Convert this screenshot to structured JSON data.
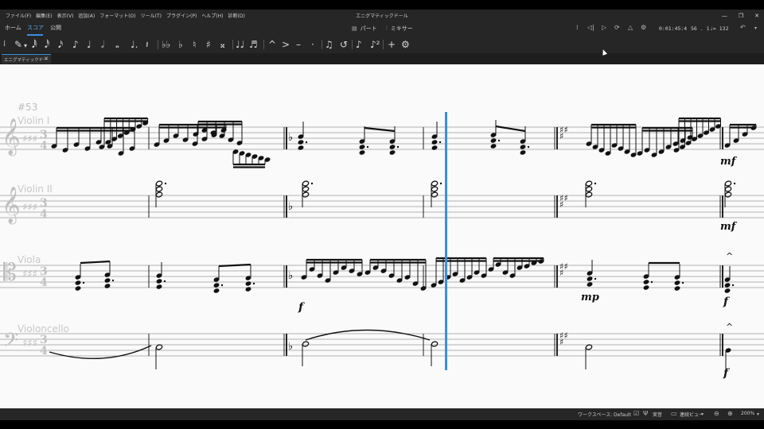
{
  "window": {
    "title": "エニグマティックドール",
    "menu": [
      "ファイル(F)",
      "編集(E)",
      "表示(V)",
      "追加(A)",
      "フォーマット(O)",
      "ツール(T)",
      "プラグイン(P)",
      "ヘルプ(H)",
      "診断(D)"
    ]
  },
  "tabs": {
    "home": "ホーム",
    "score": "スコア",
    "publish": "公開"
  },
  "toolbar": {
    "parts_label": "パート",
    "mixer_label": "ミキサー",
    "time_readout": "0:01:45:4",
    "measure_readout": "56 . 1",
    "tempo_readout": "♩= 132"
  },
  "document_tab": {
    "label": "エニグマティックドール"
  },
  "score": {
    "rehearsal": "#53",
    "instruments": [
      "Violin I",
      "Violin II",
      "Viola",
      "Violoncello"
    ],
    "time_signature": [
      "3",
      "4"
    ],
    "dynamics": {
      "violin1_last": "mf",
      "violin2_last": "mf",
      "viola_m3": "f",
      "viola_m5": "mp",
      "viola_last": "f",
      "cello_last": "f"
    }
  },
  "statusbar": {
    "workspace": "ワークスペース: Default",
    "concert_pitch": "実音",
    "view_mode": "連続ビュー",
    "zoom": "200%"
  },
  "colors": {
    "accent": "#3a8ee0",
    "playhead": "#3d8fdc",
    "chrome": "#262626"
  }
}
